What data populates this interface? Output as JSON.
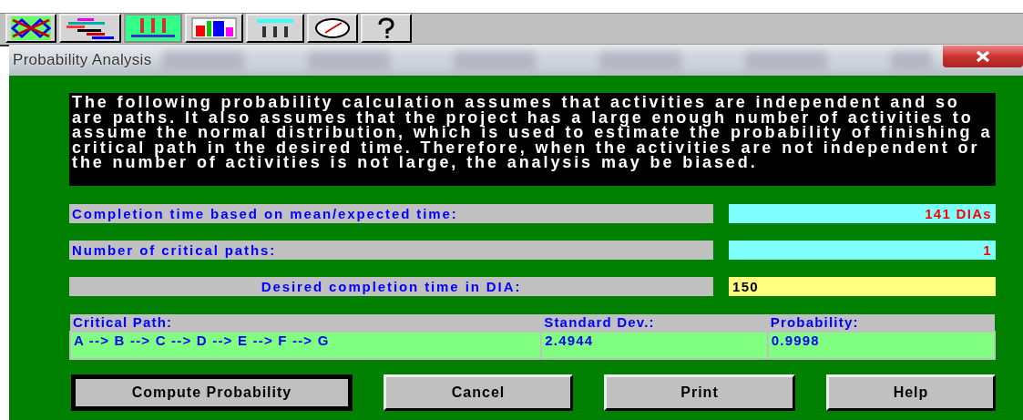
{
  "toolbar": {
    "buttons": [
      {
        "kind": "network",
        "selected": false
      },
      {
        "kind": "gantt",
        "selected": false
      },
      {
        "kind": "resources",
        "selected": true
      },
      {
        "kind": "bars",
        "selected": false
      },
      {
        "kind": "table",
        "selected": false
      },
      {
        "kind": "clock",
        "selected": false
      },
      {
        "kind": "help",
        "selected": false
      }
    ]
  },
  "window": {
    "title": "Probability Analysis"
  },
  "notice": "The following probability calculation assumes that activities are independent and so are paths. It also assumes that the project has a large enough number of activities to assume the normal distribution, which is used to estimate the probability of finishing a critical path in the desired time.  Therefore, when the activities are not independent or the number of activities is not large, the analysis may be biased.",
  "fields": [
    {
      "label": "Completion time based on mean/expected time:",
      "value": "141 DIAs",
      "kind": "readout"
    },
    {
      "label": "Number of critical paths:",
      "value": "1",
      "kind": "readout"
    },
    {
      "label": "Desired completion time in DIA:",
      "value": "150",
      "kind": "input"
    }
  ],
  "table": {
    "columns": [
      "Critical Path:",
      "Standard Dev.:",
      "Probability:"
    ],
    "rows": [
      [
        "A --> B --> C --> D --> E --> F --> G",
        "2.4944",
        "0.9998"
      ]
    ]
  },
  "buttons": [
    {
      "label": "Compute Probability",
      "default": true
    },
    {
      "label": "Cancel",
      "default": false
    },
    {
      "label": "Print",
      "default": false
    },
    {
      "label": "Help",
      "default": false
    }
  ]
}
